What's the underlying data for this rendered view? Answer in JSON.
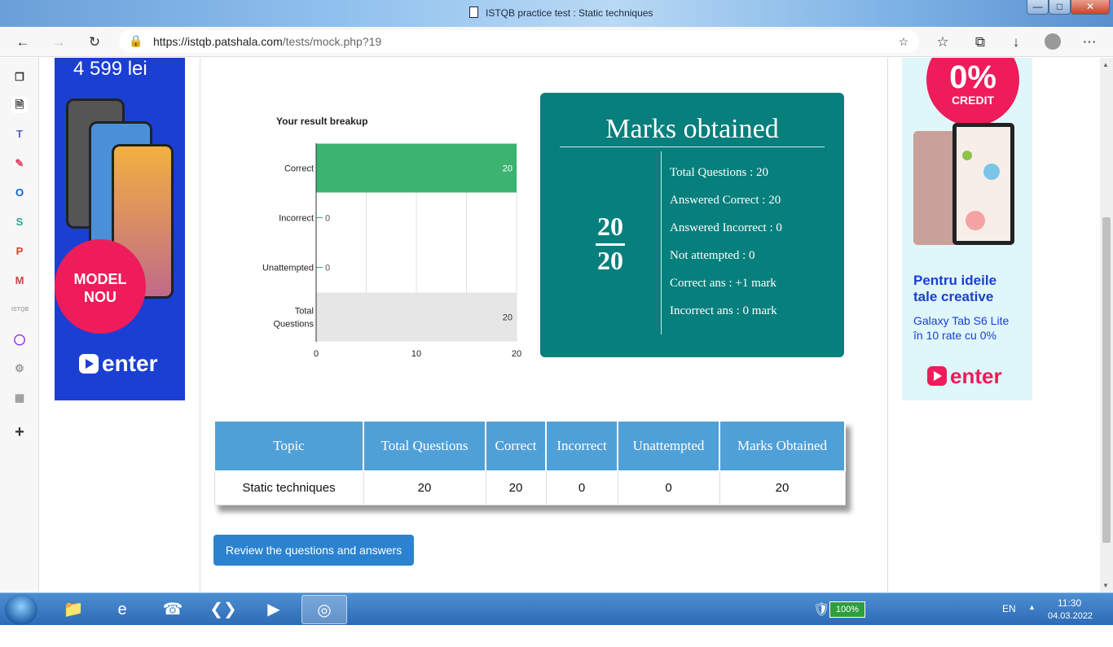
{
  "window": {
    "title": "ISTQB practice test : Static techniques"
  },
  "browser": {
    "url_host": "https://istqb.patshala.com",
    "url_path": "/tests/mock.php?19"
  },
  "ads": {
    "left": {
      "price": "4 599 lei",
      "badge_line1": "MODEL",
      "badge_line2": "NOU",
      "brand": "enter"
    },
    "right": {
      "credit_big": "0%",
      "credit_small": "CREDIT",
      "headline_1": "Pentru ideile",
      "headline_2": "tale creative",
      "sub_1": "Galaxy Tab S6 Lite",
      "sub_2": "în 10 rate cu 0%",
      "brand": "enter"
    }
  },
  "chart_data": {
    "type": "bar",
    "orientation": "horizontal",
    "title": "Your result breakup",
    "categories": [
      "Correct",
      "Incorrect",
      "Unattempted",
      "Total Questions"
    ],
    "values": [
      20,
      0,
      0,
      20
    ],
    "bar_colors": [
      "#3cb371",
      "#3cb371",
      "#3cb371",
      "#e6e6e6"
    ],
    "xlim": [
      0,
      20
    ],
    "xticks": [
      0,
      10,
      20
    ],
    "grid": true
  },
  "marks": {
    "title": "Marks obtained",
    "numerator": "20",
    "denominator": "20",
    "lines": [
      "Total Questions : 20",
      "Answered Correct : 20",
      "Answered Incorrect : 0",
      "Not attempted : 0",
      "Correct ans : +1 mark",
      "Incorrect ans : 0 mark"
    ]
  },
  "table": {
    "headers": [
      "Topic",
      "Total Questions",
      "Correct",
      "Incorrect",
      "Unattempted",
      "Marks Obtained"
    ],
    "rows": [
      [
        "Static techniques",
        "20",
        "20",
        "0",
        "0",
        "20"
      ]
    ]
  },
  "review_button": "Review the questions and answers",
  "taskbar": {
    "battery": "100%",
    "language": "EN",
    "time": "11:30",
    "date": "04.03.2022"
  },
  "colors": {
    "teal": "#077f7d",
    "table_header": "#50a0d8",
    "button": "#2b83d0",
    "bar_green": "#3cb371"
  }
}
